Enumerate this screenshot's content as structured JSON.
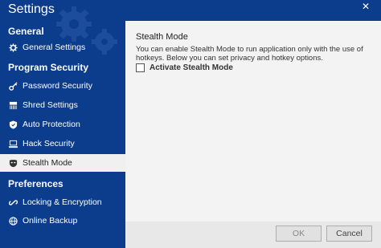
{
  "window": {
    "title": "Settings",
    "close_glyph": "✕"
  },
  "sidebar": {
    "sections": [
      {
        "label": "General"
      },
      {
        "label": "Program Security"
      },
      {
        "label": "Preferences"
      }
    ],
    "items": [
      {
        "label": "General Settings",
        "icon": "gear-icon"
      },
      {
        "label": "Password Security",
        "icon": "key-icon"
      },
      {
        "label": "Shred Settings",
        "icon": "shredder-icon"
      },
      {
        "label": "Auto Protection",
        "icon": "shield-icon"
      },
      {
        "label": "Hack Security",
        "icon": "hacker-icon"
      },
      {
        "label": "Stealth Mode",
        "icon": "mask-icon",
        "active": true
      },
      {
        "label": "Locking & Encryption",
        "icon": "link-icon"
      },
      {
        "label": "Online Backup",
        "icon": "globe-icon"
      }
    ]
  },
  "content": {
    "title": "Stealth Mode",
    "description": "You can enable Stealth Mode to run application only with the use of hotkeys. Below you can set privacy and hotkey options.",
    "checkbox_label": "Activate Stealth Mode",
    "checkbox_checked": false
  },
  "footer": {
    "ok_label": "OK",
    "cancel_label": "Cancel"
  },
  "colors": {
    "sidebar_bg": "#0b3d8c",
    "content_bg": "#f3f3f3",
    "active_item_bg": "#f0f0f0"
  }
}
